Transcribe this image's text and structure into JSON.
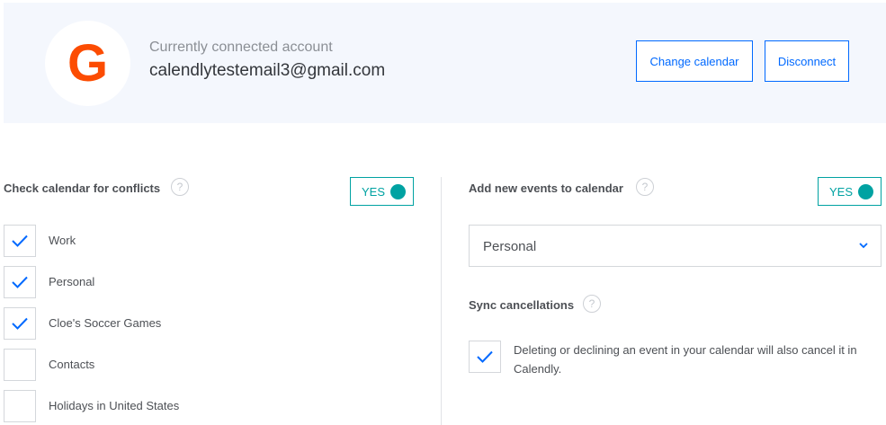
{
  "account": {
    "logo_letter": "G",
    "caption": "Currently connected account",
    "email": "calendlytestemail3@gmail.com",
    "change_label": "Change calendar",
    "disconnect_label": "Disconnect"
  },
  "conflicts": {
    "title": "Check calendar for conflicts",
    "help": "?",
    "toggle_label": "YES",
    "calendars": [
      {
        "label": "Work",
        "checked": true
      },
      {
        "label": "Personal",
        "checked": true
      },
      {
        "label": "Cloe's Soccer Games",
        "checked": true
      },
      {
        "label": "Contacts",
        "checked": false
      },
      {
        "label": "Holidays in United States",
        "checked": false
      }
    ]
  },
  "add_events": {
    "title": "Add new events to calendar",
    "help": "?",
    "toggle_label": "YES",
    "selected_calendar": "Personal"
  },
  "sync": {
    "title": "Sync cancellations",
    "help": "?",
    "checked": true,
    "description": "Deleting or declining an event in your calendar will also cancel it in Calendly."
  },
  "colors": {
    "accent_blue": "#0069ff",
    "toggle_teal": "#00a2a2",
    "google_red": "#fc4c02",
    "header_bg": "#f4f7fd"
  }
}
